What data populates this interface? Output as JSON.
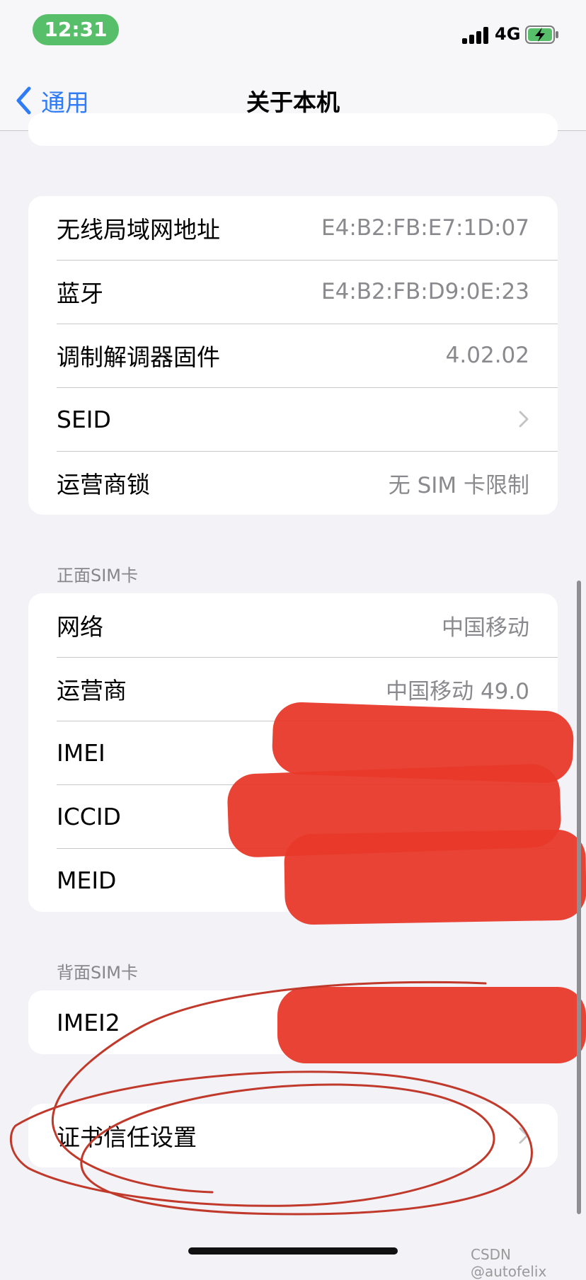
{
  "status": {
    "time": "12:31",
    "network": "4G"
  },
  "nav": {
    "back_label": "通用",
    "title": "关于本机"
  },
  "info_card": {
    "rows": [
      {
        "label": "无线局域网地址",
        "value": "E4:B2:FB:E7:1D:07"
      },
      {
        "label": "蓝牙",
        "value": "E4:B2:FB:D9:0E:23"
      },
      {
        "label": "调制解调器固件",
        "value": "4.02.02"
      },
      {
        "label": "SEID",
        "value": ""
      },
      {
        "label": "运营商锁",
        "value": "无 SIM 卡限制"
      }
    ]
  },
  "front_sim": {
    "header": "正面SIM卡",
    "rows": [
      {
        "label": "网络",
        "value": "中国移动"
      },
      {
        "label": "运营商",
        "value": "中国移动 49.0"
      },
      {
        "label": "IMEI",
        "value": ""
      },
      {
        "label": "ICCID",
        "value": ""
      },
      {
        "label": "MEID",
        "value": ""
      }
    ]
  },
  "back_sim": {
    "header": "背面SIM卡",
    "rows": [
      {
        "label": "IMEI2",
        "value": ""
      }
    ]
  },
  "cert_card": {
    "label": "证书信任设置"
  },
  "watermark": "CSDN @autofelix",
  "colors": {
    "accent": "#2f7cf6",
    "time_pill": "#57bf6a",
    "redaction": "#e8392a",
    "annotation": "#c0392b"
  }
}
